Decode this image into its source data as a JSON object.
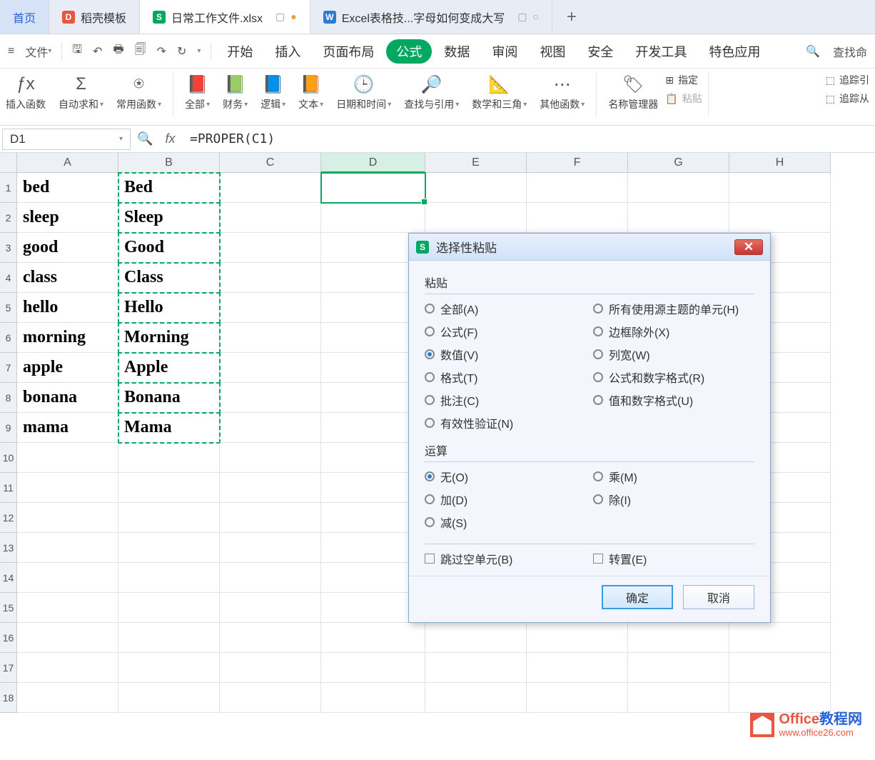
{
  "tabs": {
    "home": "首页",
    "template": "稻壳模板",
    "current": "日常工作文件.xlsx",
    "other": "Excel表格技...字母如何变成大写"
  },
  "file_menu": "文件",
  "menu": {
    "start": "开始",
    "insert": "插入",
    "page": "页面布局",
    "formula": "公式",
    "data": "数据",
    "review": "审阅",
    "view": "视图",
    "security": "安全",
    "dev": "开发工具",
    "special": "特色应用",
    "search": "查找命"
  },
  "ribbon": {
    "insert_fn": "插入函数",
    "autosum": "自动求和",
    "common": "常用函数",
    "all": "全部",
    "finance": "财务",
    "logic": "逻辑",
    "text": "文本",
    "datetime": "日期和时间",
    "lookup": "查找与引用",
    "math": "数学和三角",
    "other": "其他函数",
    "name_mgr": "名称管理器",
    "paste": "粘贴",
    "r1": "指定",
    "r2": "追踪引",
    "r3": "追踪从"
  },
  "name_box": "D1",
  "formula": "=PROPER(C1)",
  "cols": [
    "A",
    "B",
    "C",
    "D",
    "E",
    "F",
    "G",
    "H"
  ],
  "rows": [
    "1",
    "2",
    "3",
    "4",
    "5",
    "6",
    "7",
    "8",
    "9",
    "10",
    "11",
    "12",
    "13",
    "14",
    "15",
    "16",
    "17",
    "18"
  ],
  "data": {
    "A": [
      "bed",
      "sleep",
      "good",
      "class",
      "hello",
      "morning",
      "apple",
      "bonana",
      "mama"
    ],
    "B": [
      "Bed",
      "Sleep",
      "Good",
      "Class",
      "Hello",
      "Morning",
      "Apple",
      "Bonana",
      "Mama"
    ]
  },
  "dialog": {
    "title": "选择性粘贴",
    "paste_group": "粘贴",
    "paste_options": {
      "all": "全部(A)",
      "use_theme": "所有使用源主题的单元(H)",
      "formula": "公式(F)",
      "no_border": "边框除外(X)",
      "value": "数值(V)",
      "col_width": "列宽(W)",
      "format": "格式(T)",
      "formula_num": "公式和数字格式(R)",
      "comment": "批注(C)",
      "value_num": "值和数字格式(U)",
      "validation": "有效性验证(N)"
    },
    "op_group": "运算",
    "op_options": {
      "none": "无(O)",
      "mul": "乘(M)",
      "add": "加(D)",
      "div": "除(I)",
      "sub": "减(S)"
    },
    "skip_blank": "跳过空单元(B)",
    "transpose": "转置(E)",
    "ok": "确定",
    "cancel": "取消"
  },
  "watermark": {
    "main": "Office",
    "main2": "教程网",
    "sub": "www.office26.com"
  }
}
